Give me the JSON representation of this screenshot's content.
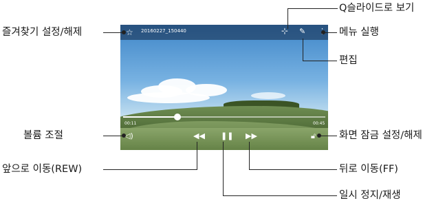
{
  "video": {
    "title": "20160227_150440",
    "time_current": "00:11",
    "time_total": "00:45",
    "progress": 0.27
  },
  "labels": {
    "favorite": "즐겨찾기 설정/해제",
    "qslide": "Q슬라이드로 보기",
    "menu": "메뉴 실행",
    "edit": "편집",
    "volume": "볼륨 조절",
    "lock": "화면 잠금 설정/해제",
    "rewind": "앞으로 이동(REW)",
    "forward": "뒤로 이동(FF)",
    "pause": "일시 정지/재생"
  },
  "icons": {
    "favorite": "star-icon",
    "qslide": "qslide-icon",
    "edit": "pencil-icon",
    "menu": "more-vert-icon",
    "volume": "speaker-icon",
    "rewind": "rewind-icon",
    "pause": "pause-icon",
    "forward": "fast-forward-icon",
    "lock": "lock-icon"
  }
}
